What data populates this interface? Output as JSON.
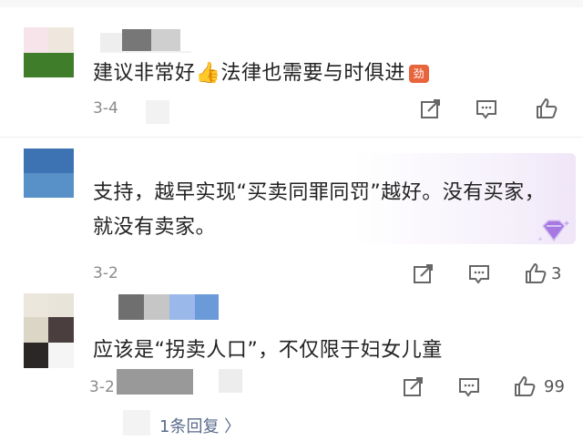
{
  "comments": [
    {
      "text": "建议非常好👍法律也需要与时俱进",
      "badge_text": "劲",
      "date": "3-4",
      "actions": [
        "share-icon",
        "comment-icon",
        "like-icon"
      ],
      "like_count": ""
    },
    {
      "text_line1": "支持，越早实现“买卖同罪同罚”越好。没有买家，",
      "text_line2": "就没有卖家。",
      "date": "3-2",
      "actions": [
        "share-icon",
        "comment-icon",
        "like-icon"
      ],
      "like_count": "3"
    },
    {
      "text": "应该是“拐卖人口”，不仅限于妇女儿童",
      "date": "3-2",
      "actions": [
        "share-icon",
        "comment-icon",
        "like-icon"
      ],
      "like_count": "99"
    }
  ],
  "replies_link": "1条回复 〉",
  "colors": {
    "accent_purple": "#a678e2",
    "link": "#5a6b8c",
    "meta": "#8a8a8a"
  }
}
